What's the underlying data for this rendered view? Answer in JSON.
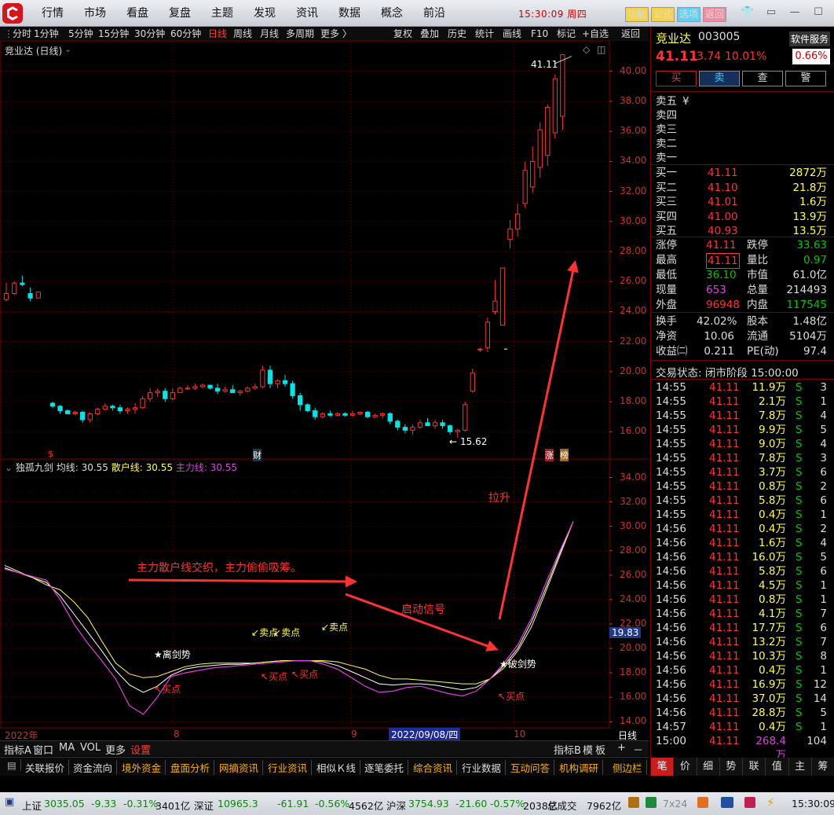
{
  "menu": [
    "行情",
    "市场",
    "看盘",
    "复盘",
    "主题",
    "发现",
    "资讯",
    "数据",
    "概念",
    "前沿"
  ],
  "clock": "15:30:09 周四",
  "top_buttons": [
    "功能",
    "公式",
    "选项",
    "返回"
  ],
  "period_tabs": [
    "分时",
    "1分钟",
    "5分钟",
    "15分钟",
    "30分钟",
    "60分钟",
    "日线",
    "周线",
    "月线",
    "多周期",
    "更多 〉"
  ],
  "right_tools": [
    "复权",
    "叠加",
    "历史",
    "统计",
    "画线",
    "F10",
    "标记",
    "+自选",
    "返回"
  ],
  "chart": {
    "name": "竞业达 (日线)",
    "high_label": "41.11",
    "low_label": "15.62",
    "fin_badge": "财",
    "dollar_badge": "$",
    "zhang_badge": "涨",
    "bang_badge": "榜"
  },
  "indicator": {
    "name": "独孤九剑",
    "avg": "均线: 30.55",
    "retail": "散户线: 30.55",
    "main": "主力线: 30.55"
  },
  "annotations": {
    "mix": "主力散户线交织，主力偷偷吸筹。",
    "start": "启动信号",
    "rise": "拉升",
    "sell1": "卖点",
    "sell2": "卖点",
    "sell3": "卖点",
    "buy1": "买点",
    "buy2": "买点",
    "buy3": "买点",
    "buy4": "买点",
    "lijian": "★离剑势",
    "pojian": "★破剑势",
    "cur_value": "19.83"
  },
  "xaxis": {
    "year": "2022年",
    "m8": "8",
    "m9": "9",
    "date": "2022/09/08/四",
    "m10": "10",
    "period": "日线"
  },
  "bottom_tabs1": [
    "指标A",
    "窗口",
    "MA",
    "VOL",
    "更多",
    "设置",
    "指标B",
    "模",
    "板",
    "+",
    "－"
  ],
  "bottom_tabs2": [
    "关联报价",
    "资金流向",
    "境外资金",
    "盘面分析",
    "网摘资讯",
    "行业资讯",
    "相似Ｋ线",
    "逐笔委托",
    "综合资讯",
    "行业数据",
    "互动问答",
    "机构调研",
    "侧边栏"
  ],
  "stock": {
    "name": "竞业达",
    "code": "003005",
    "service": "软件服务",
    "price": "41.11",
    "chg": "3.74",
    "pct": "10.01%",
    "turnover_pct": "0.66%"
  },
  "trade_buttons": [
    "买",
    "卖",
    "查",
    "警"
  ],
  "sell_levels": [
    {
      "l": "卖五",
      "p": "¥",
      "v": ""
    },
    {
      "l": "卖四",
      "p": "",
      "v": ""
    },
    {
      "l": "卖三",
      "p": "",
      "v": ""
    },
    {
      "l": "卖二",
      "p": "",
      "v": ""
    },
    {
      "l": "卖一",
      "p": "",
      "v": ""
    }
  ],
  "buy_levels": [
    {
      "l": "买一",
      "p": "41.11",
      "v": "2872万"
    },
    {
      "l": "买二",
      "p": "41.10",
      "v": "21.8万"
    },
    {
      "l": "买三",
      "p": "41.01",
      "v": "1.6万"
    },
    {
      "l": "买四",
      "p": "41.00",
      "v": "13.9万"
    },
    {
      "l": "买五",
      "p": "40.93",
      "v": "13.5万"
    }
  ],
  "stats": [
    {
      "a": "涨停",
      "av": "41.11",
      "b": "跌停",
      "bv": "33.63"
    },
    {
      "a": "最高",
      "av": "41.11",
      "b": "量比",
      "bv": "0.97"
    },
    {
      "a": "最低",
      "av": "36.10",
      "b": "市值",
      "bv": "61.0亿"
    },
    {
      "a": "现量",
      "av": "653",
      "b": "总量",
      "bv": "214493"
    },
    {
      "a": "外盘",
      "av": "96948",
      "b": "内盘",
      "bv": "117545"
    }
  ],
  "stats2": [
    {
      "a": "换手",
      "av": "42.02%",
      "b": "股本",
      "bv": "1.48亿"
    },
    {
      "a": "净资",
      "av": "10.06",
      "b": "流通",
      "bv": "5104万"
    },
    {
      "a": "收益㈡",
      "av": "0.211",
      "b": "PE(动)",
      "bv": "97.4"
    }
  ],
  "trade_status": "交易状态: 闭市阶段 15:00:00",
  "ticks": [
    [
      "14:55",
      "41.11",
      "11.9万",
      "S",
      "3"
    ],
    [
      "14:55",
      "41.11",
      "2.1万",
      "S",
      "1"
    ],
    [
      "14:55",
      "41.11",
      "7.8万",
      "S",
      "4"
    ],
    [
      "14:55",
      "41.11",
      "9.9万",
      "S",
      "5"
    ],
    [
      "14:55",
      "41.11",
      "9.0万",
      "S",
      "4"
    ],
    [
      "14:55",
      "41.11",
      "7.8万",
      "S",
      "3"
    ],
    [
      "14:55",
      "41.11",
      "3.7万",
      "S",
      "6"
    ],
    [
      "14:55",
      "41.11",
      "0.8万",
      "S",
      "2"
    ],
    [
      "14:55",
      "41.11",
      "5.8万",
      "S",
      "6"
    ],
    [
      "14:55",
      "41.11",
      "0.4万",
      "S",
      "1"
    ],
    [
      "14:56",
      "41.11",
      "0.4万",
      "S",
      "2"
    ],
    [
      "14:56",
      "41.11",
      "1.6万",
      "S",
      "4"
    ],
    [
      "14:56",
      "41.11",
      "16.0万",
      "S",
      "5"
    ],
    [
      "14:56",
      "41.11",
      "5.8万",
      "S",
      "6"
    ],
    [
      "14:56",
      "41.11",
      "4.5万",
      "S",
      "1"
    ],
    [
      "14:56",
      "41.11",
      "0.8万",
      "S",
      "1"
    ],
    [
      "14:56",
      "41.11",
      "4.1万",
      "S",
      "7"
    ],
    [
      "14:56",
      "41.11",
      "17.7万",
      "S",
      "6"
    ],
    [
      "14:56",
      "41.11",
      "13.2万",
      "S",
      "7"
    ],
    [
      "14:56",
      "41.11",
      "10.3万",
      "S",
      "8"
    ],
    [
      "14:56",
      "41.11",
      "0.4万",
      "S",
      "1"
    ],
    [
      "14:56",
      "41.11",
      "16.9万",
      "S",
      "12"
    ],
    [
      "14:56",
      "41.11",
      "37.0万",
      "S",
      "14"
    ],
    [
      "14:56",
      "41.11",
      "28.8万",
      "S",
      "5"
    ],
    [
      "14:57",
      "41.11",
      "0.4万",
      "S",
      "1"
    ],
    [
      "15:00",
      "41.11",
      "268.4万",
      "",
      "104"
    ]
  ],
  "right_tabs": [
    "笔",
    "价",
    "细",
    "势",
    "联",
    "值",
    "主",
    "筹"
  ],
  "status": {
    "sh_label": "上证",
    "sh_val": "3035.05",
    "sh_chg": "-9.33",
    "sh_pct": "-0.31%",
    "sh_amt": "3401亿",
    "sz_label": "深证",
    "sz_val": "10965.3",
    "sz_chg": "-61.91",
    "sz_pct": "-0.56%",
    "sz_amt": "4562亿",
    "hs_label": "沪深",
    "hs_val": "3754.93",
    "hs_chg": "-21.60",
    "hs_pct": "-0.57%",
    "hs_amt": "2038亿",
    "total_label": "总成交",
    "total_val": "7962亿",
    "badge": "7x24",
    "time": "15:30:09"
  },
  "chart_data": {
    "type": "candlestick",
    "ylim": [
      14.5,
      41.5
    ],
    "yticks": [
      16,
      18,
      20,
      22,
      24,
      26,
      28,
      30,
      32,
      34,
      36,
      38,
      40
    ],
    "candles": [
      [
        5.2,
        24.8,
        25.9,
        24.7,
        25.2
      ],
      [
        5.2,
        25.2,
        26.0,
        25.1,
        25.9
      ],
      [
        5.2,
        25.9,
        26.4,
        25.7,
        25.8
      ],
      [
        5.2,
        25.2,
        25.6,
        24.7,
        24.9
      ],
      [
        5.2,
        24.9,
        25.3,
        24.9,
        25.3
      ],
      [
        5.3,
        17.9,
        18.0,
        17.6,
        17.7
      ],
      [
        5.3,
        17.7,
        17.8,
        17.2,
        17.4
      ],
      [
        5.3,
        17.4,
        17.5,
        17.2,
        17.2
      ],
      [
        5.3,
        17.2,
        17.4,
        17.1,
        17.3
      ],
      [
        5.3,
        17.3,
        17.4,
        16.6,
        16.8
      ],
      [
        5.3,
        16.8,
        17.3,
        16.6,
        17.2
      ],
      [
        5.3,
        17.2,
        17.6,
        17.1,
        17.5
      ],
      [
        5.3,
        17.5,
        17.9,
        17.4,
        17.7
      ],
      [
        5.3,
        17.7,
        17.8,
        17.4,
        17.6
      ],
      [
        5.3,
        17.6,
        17.8,
        17.2,
        17.4
      ],
      [
        5.3,
        17.4,
        17.6,
        17.2,
        17.5
      ],
      [
        5.3,
        17.5,
        17.9,
        17.2,
        17.6
      ],
      [
        5.3,
        17.6,
        18.4,
        17.5,
        18.2
      ],
      [
        5.3,
        18.2,
        18.9,
        18.0,
        18.6
      ],
      [
        5.3,
        18.6,
        18.9,
        18.3,
        18.7
      ],
      [
        5.3,
        18.7,
        18.9,
        18.0,
        18.2
      ],
      [
        5.3,
        18.2,
        18.9,
        18.1,
        18.6
      ],
      [
        5.3,
        18.6,
        19.0,
        18.6,
        18.9
      ],
      [
        5.3,
        18.9,
        19.1,
        18.8,
        18.9
      ],
      [
        5.3,
        18.9,
        19.2,
        18.8,
        19.0
      ],
      [
        5.3,
        19.0,
        19.2,
        18.9,
        19.1
      ],
      [
        5.3,
        19.1,
        19.1,
        18.8,
        18.9
      ],
      [
        5.3,
        18.9,
        19.2,
        18.5,
        18.7
      ],
      [
        5.3,
        18.7,
        19.0,
        18.6,
        18.8
      ],
      [
        5.3,
        18.8,
        19.1,
        18.6,
        18.6
      ],
      [
        5.3,
        18.6,
        18.8,
        18.4,
        18.7
      ],
      [
        5.3,
        18.7,
        19.0,
        18.6,
        18.9
      ],
      [
        5.3,
        18.9,
        19.2,
        18.8,
        19.0
      ],
      [
        5.3,
        19.0,
        20.4,
        18.9,
        20.1
      ],
      [
        5.3,
        20.1,
        20.4,
        18.9,
        19.2
      ],
      [
        5.3,
        19.2,
        19.5,
        18.9,
        19.4
      ],
      [
        5.3,
        19.4,
        19.8,
        19.0,
        19.2
      ],
      [
        5.3,
        19.2,
        19.4,
        18.2,
        18.4
      ],
      [
        5.3,
        18.4,
        18.6,
        17.4,
        17.8
      ],
      [
        5.3,
        17.8,
        17.9,
        17.3,
        17.4
      ],
      [
        5.3,
        17.4,
        17.6,
        16.8,
        17.0
      ],
      [
        5.3,
        17.0,
        17.3,
        16.9,
        17.2
      ],
      [
        5.3,
        17.2,
        17.4,
        17.0,
        17.1
      ],
      [
        5.3,
        17.1,
        17.3,
        17.0,
        17.2
      ],
      [
        5.3,
        17.2,
        17.3,
        17.0,
        17.1
      ],
      [
        5.3,
        17.1,
        17.4,
        17.0,
        17.2
      ],
      [
        5.3,
        17.2,
        17.3,
        17.1,
        17.3
      ],
      [
        5.3,
        17.3,
        17.4,
        16.9,
        17.0
      ],
      [
        5.3,
        17.0,
        17.2,
        16.9,
        17.1
      ],
      [
        5.3,
        17.1,
        17.3,
        16.9,
        17.2
      ],
      [
        5.3,
        17.2,
        17.3,
        16.5,
        16.7
      ],
      [
        5.3,
        16.7,
        16.8,
        16.1,
        16.3
      ],
      [
        5.3,
        16.3,
        16.5,
        15.9,
        16.1
      ],
      [
        5.3,
        16.1,
        16.5,
        15.8,
        16.3
      ],
      [
        5.3,
        16.3,
        16.8,
        16.2,
        16.6
      ],
      [
        5.3,
        16.6,
        16.9,
        16.4,
        16.4
      ],
      [
        5.3,
        16.4,
        16.8,
        16.2,
        16.6
      ],
      [
        5.3,
        16.6,
        16.8,
        16.2,
        16.4
      ],
      [
        5.3,
        16.4,
        16.5,
        15.8,
        16.0
      ],
      [
        5.3,
        16.0,
        16.2,
        15.6,
        16.1
      ],
      [
        5.3,
        16.1,
        18.0,
        16.0,
        17.8
      ],
      [
        5.3,
        18.7,
        20.2,
        18.6,
        19.9
      ],
      [
        5.3,
        21.5,
        21.6,
        21.3,
        21.5
      ],
      [
        5.3,
        21.6,
        23.6,
        21.3,
        23.3
      ],
      [
        5.3,
        24.0,
        26.1,
        23.8,
        24.7
      ],
      [
        5.3,
        23.1,
        26.9,
        23.1,
        26.9
      ],
      [
        5.3,
        28.8,
        30.1,
        28.2,
        29.5
      ],
      [
        5.3,
        29.5,
        31.2,
        29.0,
        30.5
      ],
      [
        5.3,
        31.2,
        34.0,
        30.9,
        33.4
      ],
      [
        5.3,
        32.3,
        35.0,
        31.9,
        34.0
      ],
      [
        5.3,
        33.6,
        36.6,
        32.9,
        36.1
      ],
      [
        5.3,
        34.4,
        37.8,
        33.7,
        37.6
      ],
      [
        5.3,
        35.9,
        39.8,
        35.5,
        39.5
      ],
      [
        5.3,
        37.0,
        41.1,
        36.1,
        41.1
      ]
    ],
    "indicator": {
      "ylim": [
        13.5,
        35.0
      ],
      "yticks": [
        14,
        16,
        18,
        20,
        22,
        24,
        26,
        28,
        30,
        32,
        34
      ],
      "retail": [
        26.8,
        26.3,
        25.8,
        25.2,
        24.8,
        23.8,
        22.5,
        20.6,
        18.8,
        17.9,
        17.6,
        17.7,
        18.1,
        18.5,
        18.7,
        18.8,
        18.8,
        18.8,
        18.8,
        18.9,
        19.0,
        19.0,
        19.0,
        19.0,
        18.9,
        18.6,
        18.3,
        17.8,
        17.5,
        17.5,
        17.4,
        17.3,
        17.2,
        17.1,
        17.1,
        17.5,
        18.4,
        19.8,
        21.8,
        24.6,
        27.5,
        30.4
      ],
      "main": [
        26.5,
        26.2,
        25.9,
        25.6,
        24.0,
        22.0,
        20.4,
        19.0,
        17.5,
        15.3,
        14.6,
        16.0,
        17.7,
        18.0,
        18.2,
        18.4,
        18.5,
        18.6,
        18.7,
        18.8,
        18.9,
        19.0,
        19.0,
        18.7,
        18.3,
        17.6,
        16.9,
        16.4,
        16.5,
        16.8,
        16.9,
        16.6,
        16.3,
        16.1,
        16.5,
        17.5,
        18.8,
        20.3,
        22.5,
        25.3,
        27.9,
        30.4
      ],
      "avg": [
        26.6,
        26.2,
        25.8,
        25.4,
        24.3,
        22.8,
        21.3,
        19.8,
        18.2,
        17.0,
        16.4,
        16.9,
        17.8,
        18.3,
        18.5,
        18.6,
        18.7,
        18.7,
        18.8,
        18.9,
        19.0,
        19.0,
        19.0,
        18.9,
        18.6,
        18.1,
        17.6,
        17.1,
        17.0,
        17.1,
        17.1,
        17.0,
        16.8,
        16.6,
        16.8,
        17.5,
        18.6,
        20.0,
        22.2,
        24.9,
        27.7,
        30.4
      ]
    }
  },
  "colors": {
    "up": "#ff3232",
    "down": "#00e6e6",
    "retail": "#ffff50",
    "main": "#e040e0",
    "avg": "#ffffff",
    "grid": "#7a0000"
  }
}
